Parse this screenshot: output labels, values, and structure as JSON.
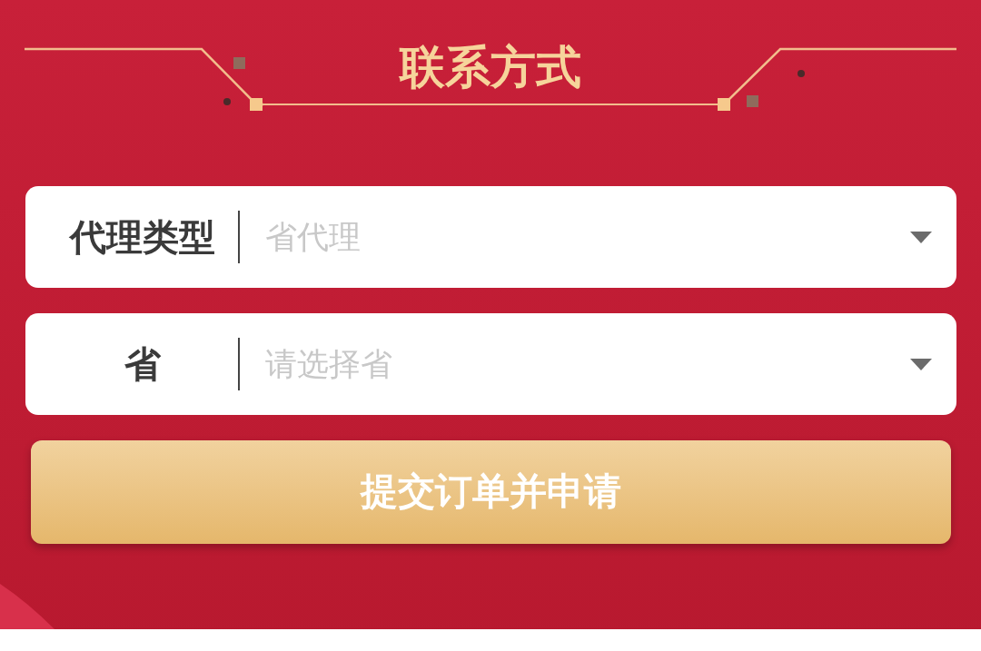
{
  "section_title": "联系方式",
  "fields": [
    {
      "label": "代理类型",
      "placeholder": "省代理"
    },
    {
      "label": "省",
      "placeholder": "请选择省"
    }
  ],
  "submit_button": "提交订单并申请"
}
